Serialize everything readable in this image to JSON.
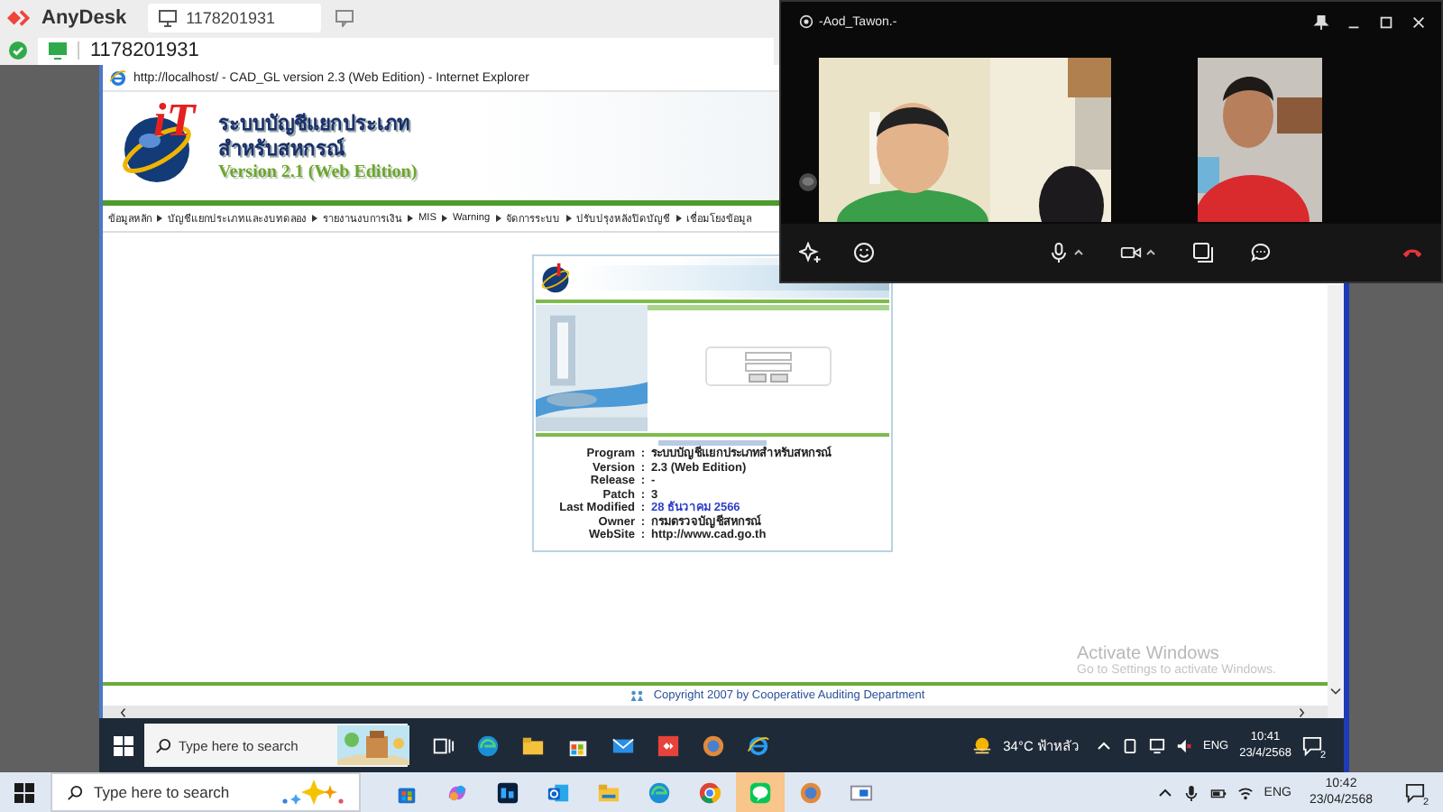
{
  "anydesk": {
    "app_name": "AnyDesk",
    "tab_label": "1178201931",
    "address": "1178201931"
  },
  "browser": {
    "title": "http://localhost/ - CAD_GL version 2.3 (Web Edition) - Internet Explorer",
    "logo_text": "iT",
    "site_title": [
      "ระบบบัญชีแยกประเภท",
      "สำหรับสหกรณ์"
    ],
    "site_version": "Version 2.1 (Web Edition)",
    "menu": [
      "ข้อมูลหลัก",
      "บัญชีแยกประเภทและงบทดลอง",
      "รายงานงบการเงิน",
      "MIS",
      "Warning",
      "จัดการระบบ",
      "ปรับปรุงหลังปิดบัญชี",
      "เชื่อมโยงข้อมูล"
    ],
    "about": [
      {
        "label": "Program",
        "colon": ":",
        "value": "ระบบบัญชีแยกประเภทสำหรับสหกรณ์",
        "kind": "plain"
      },
      {
        "label": "Version",
        "colon": ":",
        "value": "2.3 (Web Edition)",
        "kind": "plain"
      },
      {
        "label": "Release",
        "colon": ":",
        "value": "-",
        "kind": "plain"
      },
      {
        "label": "Patch",
        "colon": ":",
        "value": "3",
        "kind": "plain"
      },
      {
        "label": "Last Modified",
        "colon": ":",
        "value": "28 ธันวาคม 2566",
        "kind": "highlight"
      },
      {
        "label": "Owner",
        "colon": ":",
        "value": "กรมตรวจบัญชีสหกรณ์",
        "kind": "plain"
      },
      {
        "label": "WebSite",
        "colon": ":",
        "value": "http://www.cad.go.th",
        "kind": "plain"
      }
    ],
    "footer": "Copyright 2007  by Cooperative Auditing Department",
    "activation": {
      "title": "Activate Windows",
      "subtitle": "Go to Settings to activate Windows."
    }
  },
  "remote_taskbar": {
    "search": {
      "placeholder": "Type here to search"
    },
    "apps": [
      {
        "kind": "task-view"
      },
      {
        "kind": "edge"
      },
      {
        "kind": "explorer"
      },
      {
        "kind": "store"
      },
      {
        "kind": "mail"
      },
      {
        "kind": "anydesk"
      },
      {
        "kind": "globe"
      },
      {
        "kind": "ie"
      }
    ],
    "weather": "34°C ฟ้าหลัว",
    "language": "ENG",
    "time": "10:41",
    "date": "23/4/2568",
    "notifications": "2"
  },
  "local_taskbar": {
    "search": {
      "placeholder": "Type here to search"
    },
    "apps": [
      {
        "kind": "store",
        "selected": false
      },
      {
        "kind": "copilot",
        "selected": false
      },
      {
        "kind": "photoshop",
        "selected": false
      },
      {
        "kind": "outlook",
        "selected": false
      },
      {
        "kind": "explorer",
        "selected": false
      },
      {
        "kind": "edge",
        "selected": false
      },
      {
        "kind": "chrome",
        "selected": false
      },
      {
        "kind": "line",
        "selected": true
      },
      {
        "kind": "globe",
        "selected": false
      },
      {
        "kind": "window",
        "selected": false
      }
    ],
    "language": "ENG",
    "time": "10:42",
    "date": "23/04/2568",
    "notifications": "2"
  },
  "call": {
    "caller": "-Aod_Tawon.-"
  }
}
